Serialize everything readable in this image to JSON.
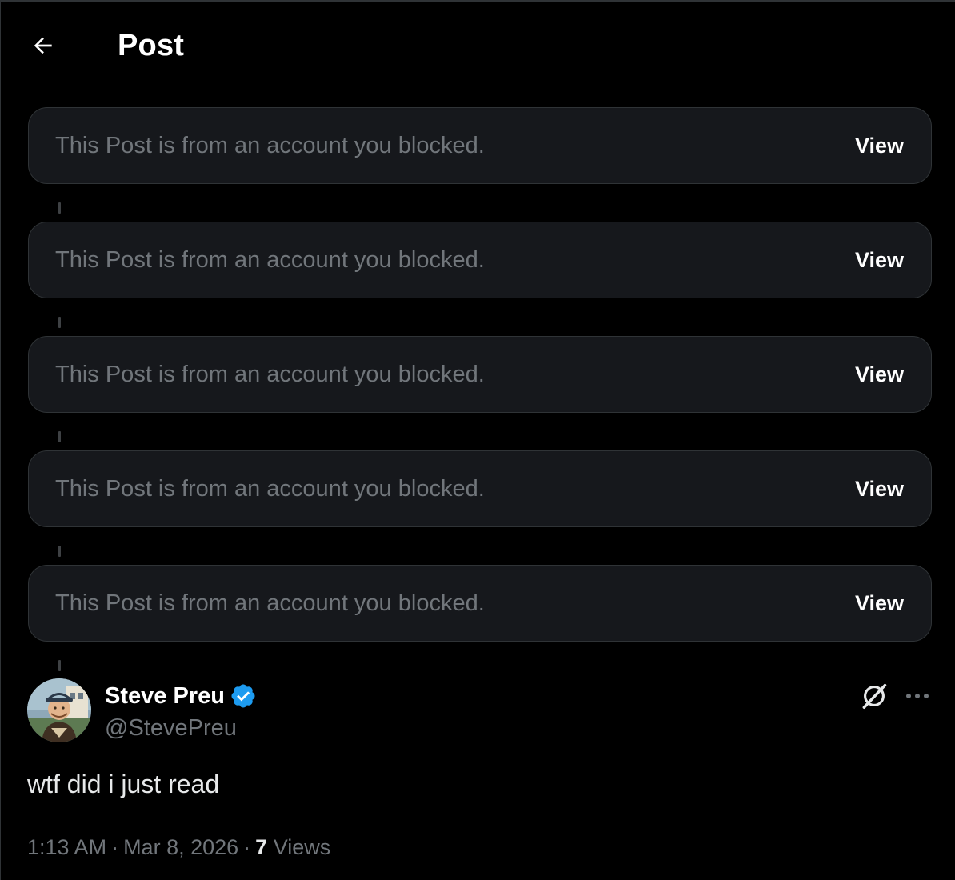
{
  "header": {
    "title": "Post"
  },
  "blocked_posts": [
    {
      "text": "This Post is from an account you blocked.",
      "action": "View"
    },
    {
      "text": "This Post is from an account you blocked.",
      "action": "View"
    },
    {
      "text": "This Post is from an account you blocked.",
      "action": "View"
    },
    {
      "text": "This Post is from an account you blocked.",
      "action": "View"
    },
    {
      "text": "This Post is from an account you blocked.",
      "action": "View"
    }
  ],
  "post": {
    "author_name": "Steve Preu",
    "author_handle": "@StevePreu",
    "verified": true,
    "text": "wtf did i just read",
    "time": "1:13 AM",
    "separator": "·",
    "date": "Mar 8, 2026",
    "views_count": "7",
    "views_label": "Views"
  },
  "icons": {
    "back": "arrow-left-icon",
    "verified": "verified-badge-icon",
    "grok": "grok-icon",
    "more": "more-horizontal-icon"
  },
  "colors": {
    "background": "#000000",
    "card_background": "#16181c",
    "card_border": "#2f3336",
    "muted_text": "#71767b",
    "primary_text": "#e7e9ea",
    "verified_blue": "#1d9bf0"
  }
}
